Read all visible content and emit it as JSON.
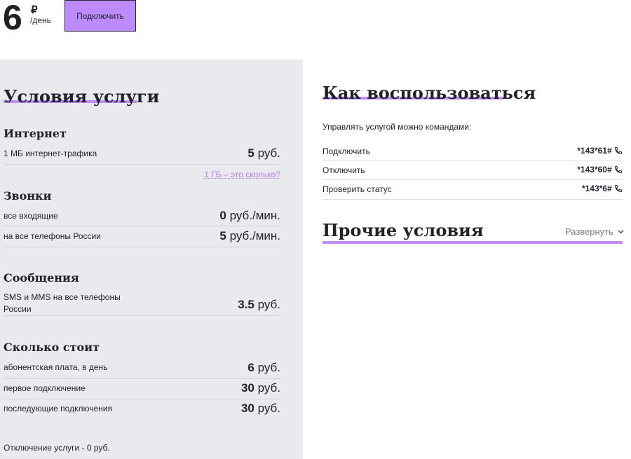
{
  "price": {
    "amount": "6",
    "currency": "₽",
    "period": "/день"
  },
  "connect_button": "Подключить",
  "conditions": {
    "title": "Условия услуги",
    "internet": {
      "title": "Интернет",
      "rows": [
        {
          "label": "1 МБ интернет-трафика",
          "value": "5",
          "unit": " руб."
        }
      ],
      "link": "1 ГБ – это сколько?"
    },
    "calls": {
      "title": "Звонки",
      "rows": [
        {
          "label": "все входящие",
          "value": "0",
          "unit": " руб./мин."
        },
        {
          "label": "на все телефоны России",
          "value": "5",
          "unit": " руб./мин."
        }
      ]
    },
    "messages": {
      "title": "Сообщения",
      "rows": [
        {
          "label": "SMS и MMS на все телефоны России",
          "value": "3.5",
          "unit": " руб."
        }
      ]
    },
    "cost": {
      "title": "Сколько стоит",
      "rows": [
        {
          "label": "абонентская плата, в день",
          "value": "6",
          "unit": " руб."
        },
        {
          "label": "первое подключение",
          "value": "30",
          "unit": " руб."
        },
        {
          "label": "последующие подключения",
          "value": "30",
          "unit": " руб."
        }
      ]
    },
    "footer": "Отключение услуги - 0 руб."
  },
  "how_to": {
    "title": "Как воспользоваться",
    "intro": "Управлять услугой можно командами:",
    "commands": [
      {
        "label": "Подключить",
        "code": "*143*61#"
      },
      {
        "label": "Отключить",
        "code": "*143*60#"
      },
      {
        "label": "Проверить статус",
        "code": "*143*6#"
      }
    ],
    "icon": "phone-icon"
  },
  "other": {
    "title": "Прочие условия",
    "expand_label": "Развернуть",
    "icon": "chevron-down-icon"
  },
  "colors": {
    "accent": "#bd8bfb",
    "underline": "#c08cf6",
    "panel": "#e9eaee",
    "link": "#b57ff1"
  }
}
